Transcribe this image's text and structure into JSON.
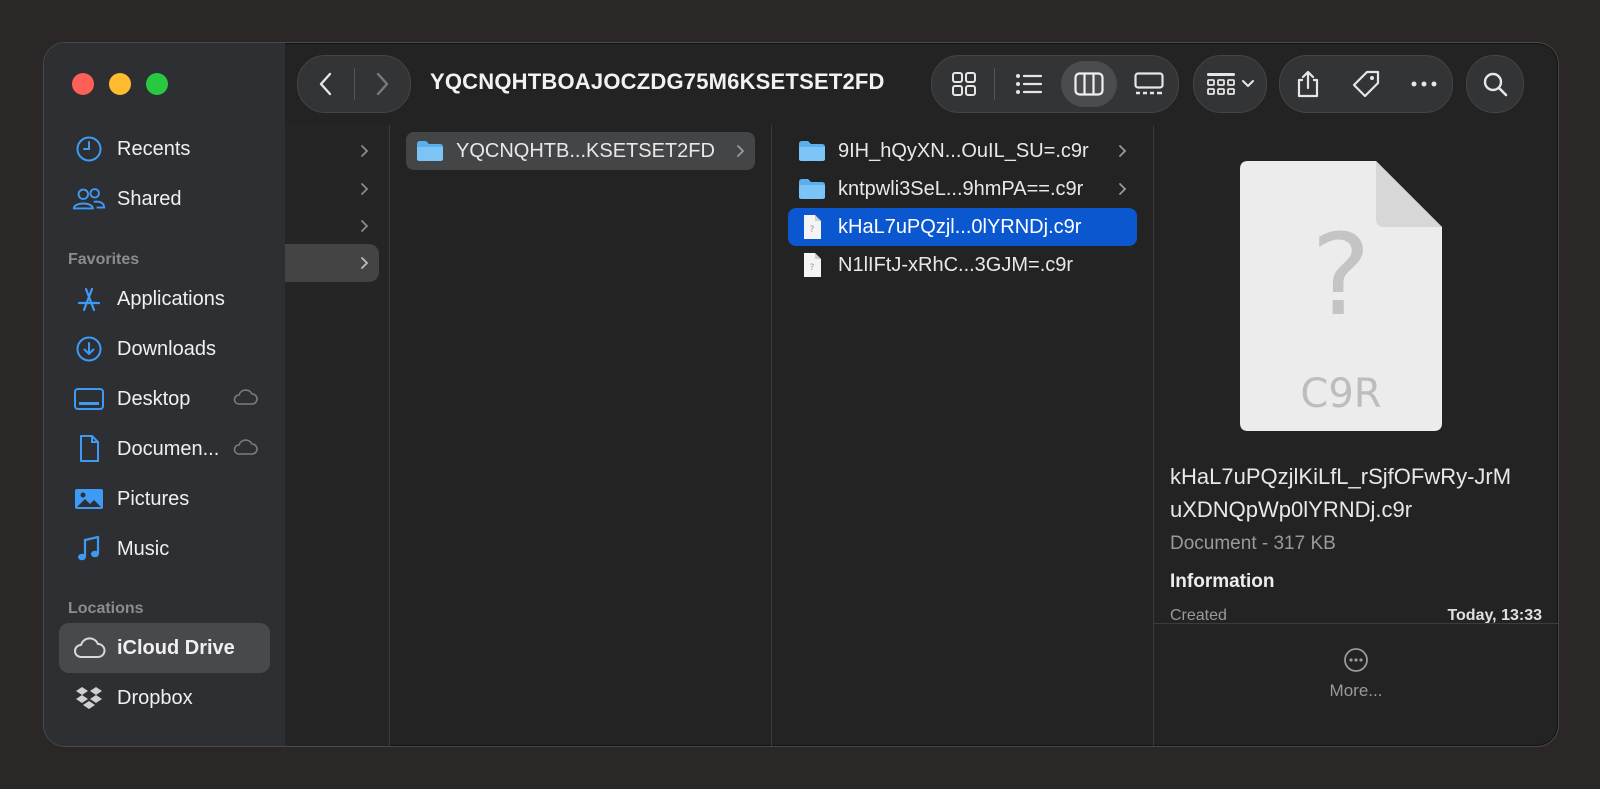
{
  "toolbar": {
    "path_title": "YQCNQHTBOAJOCZDG75M6KSETSET2FD"
  },
  "sidebar": {
    "items_top": [
      {
        "label": "Recents",
        "icon": "clock-icon"
      },
      {
        "label": "Shared",
        "icon": "shared-people-icon"
      }
    ],
    "favorites_header": "Favorites",
    "favorites": [
      {
        "label": "Applications",
        "icon": "applications-icon"
      },
      {
        "label": "Downloads",
        "icon": "download-icon"
      },
      {
        "label": "Desktop",
        "icon": "desktop-icon"
      },
      {
        "label": "Documen...",
        "icon": "document-icon"
      },
      {
        "label": "Pictures",
        "icon": "pictures-icon"
      },
      {
        "label": "Music",
        "icon": "music-icon"
      }
    ],
    "locations_header": "Locations",
    "locations": [
      {
        "label": "iCloud Drive",
        "icon": "icloud-icon",
        "selected": true
      },
      {
        "label": "Dropbox",
        "icon": "dropbox-icon"
      }
    ]
  },
  "columns": {
    "col2": [
      {
        "label": "YQCNQHTB...KSETSET2FD",
        "type": "folder"
      }
    ],
    "col3": [
      {
        "label": "9IH_hQyXN...OuIL_SU=.c9r",
        "type": "folder"
      },
      {
        "label": "kntpwli3SeL...9hmPA==.c9r",
        "type": "folder"
      },
      {
        "label": "kHaL7uPQzjl...0lYRNDj.c9r",
        "type": "file",
        "selected": true
      },
      {
        "label": "N1lIFtJ-xRhC...3GJM=.c9r",
        "type": "file"
      }
    ]
  },
  "preview": {
    "ext": "C9R",
    "question": "?",
    "filename": "kHaL7uPQzjlKiLfL_rSjfOFwRy-JrMuXDNQpWp0lYRNDj.c9r",
    "kind_size": "Document - 317 KB",
    "info_header": "Information",
    "created_label": "Created",
    "created_value": "Today, 13:33",
    "more_label": "More..."
  },
  "colors": {
    "selection": "#0a57d0",
    "accent_icon": "#3e9bf5"
  }
}
